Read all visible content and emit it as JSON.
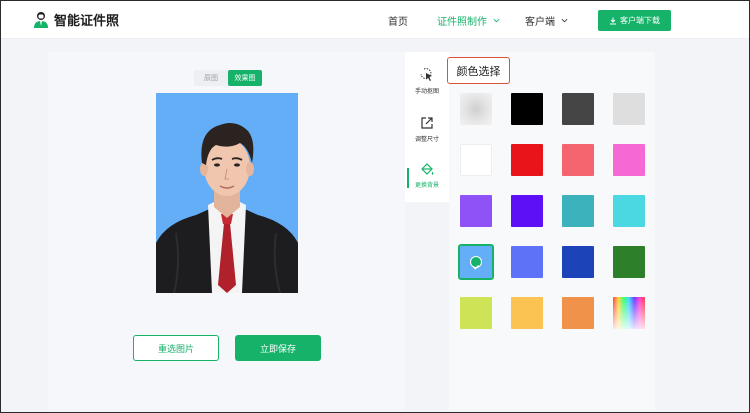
{
  "app": {
    "title": "智能证件照"
  },
  "nav": {
    "home": "首页",
    "id_photo": "证件照制作",
    "client": "客户端",
    "download": "客户端下载"
  },
  "view_toggle": {
    "original": "原图",
    "effect": "效果图",
    "active": "effect"
  },
  "actions": {
    "reselect": "重选图片",
    "save": "立即保存"
  },
  "tools": [
    {
      "label": "手动抠图",
      "icon": "cursor-select-icon",
      "active": false
    },
    {
      "label": "调整尺寸",
      "icon": "resize-icon",
      "active": false
    },
    {
      "label": "更换背景",
      "icon": "paint-bucket-icon",
      "active": true
    }
  ],
  "color_panel": {
    "title": "颜色选择",
    "swatches": [
      {
        "color": "#e4e4e4",
        "name": "blur"
      },
      {
        "color": "#000000"
      },
      {
        "color": "#454545"
      },
      {
        "color": "#dedede"
      },
      {
        "color": "#ffffff"
      },
      {
        "color": "#e8141a"
      },
      {
        "color": "#f56570"
      },
      {
        "color": "#f668d3"
      },
      {
        "color": "#8f52f7"
      },
      {
        "color": "#5d0ff5"
      },
      {
        "color": "#3bb2bc"
      },
      {
        "color": "#4bd8e3"
      },
      {
        "color": "#63aef7",
        "selected": true
      },
      {
        "color": "#5e72f8"
      },
      {
        "color": "#1d43b8"
      },
      {
        "color": "#2e7f2a"
      },
      {
        "color": "#cfe356"
      },
      {
        "color": "#fbc351"
      },
      {
        "color": "#f1924a"
      },
      {
        "color": "gradient",
        "name": "custom"
      }
    ]
  },
  "colors": {
    "accent": "#17b26a",
    "photo_bg": "#63aef7"
  }
}
